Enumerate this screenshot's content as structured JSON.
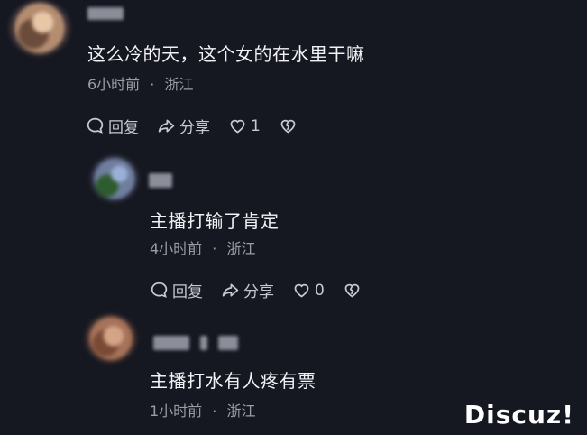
{
  "comments": [
    {
      "text": "这么冷的天，这个女的在水里干嘛",
      "time": "6小时前",
      "location": "浙江",
      "reply_label": "回复",
      "share_label": "分享",
      "like_count": "1"
    },
    {
      "text": "主播打输了肯定",
      "time": "4小时前",
      "location": "浙江",
      "reply_label": "回复",
      "share_label": "分享",
      "like_count": "0"
    },
    {
      "text": "主播打水有人疼有票",
      "time": "1小时前",
      "location": "浙江"
    }
  ],
  "meta_separator": "·",
  "watermark": "Discuz!"
}
